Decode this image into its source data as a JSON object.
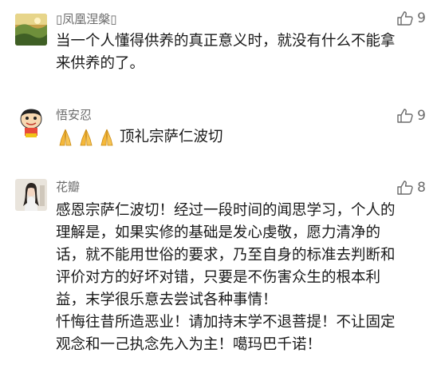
{
  "comments": [
    {
      "name": "▯凤凰涅槃▯",
      "likes": "9",
      "lines": [
        "当一个人懂得供养的真正意义时，就没有什么不能拿",
        "来供养的了。"
      ]
    },
    {
      "name": "悟安忍",
      "likes": "9",
      "emoji_count": 3,
      "text": "顶礼宗萨仁波切"
    },
    {
      "name": "花瓣",
      "likes": "8",
      "lines": [
        "感恩宗萨仁波切！经过一段时间的闻思学习，个人的",
        "理解是，如果实修的基础是发心虔敬，愿力清净的",
        "话，就不能用世俗的要求，乃至自身的标准去判断和",
        "评价对方的好坏对错，只要是不伤害众生的根本利",
        "益，末学很乐意去尝试各种事情！",
        "忏悔往昔所造恶业！请加持末学不退菩提！不让固定",
        "观念和一己执念先入为主！噶玛巴千诺！"
      ]
    }
  ],
  "icons": {
    "like": "thumbs-up-outline-icon",
    "emoji": "folded-hands-icon"
  },
  "colors": {
    "meta": "#6b6b6b",
    "text": "#1a1a1a",
    "emoji": "#f5b83a"
  }
}
